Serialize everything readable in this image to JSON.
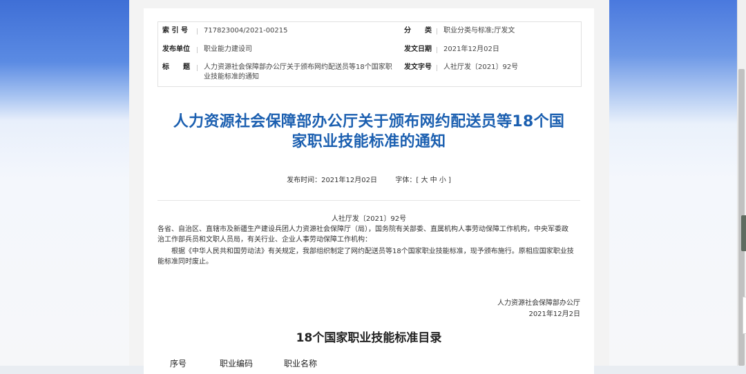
{
  "meta": {
    "index_label": "索 引 号",
    "index_value": "717823004/2021-00215",
    "category_label": "分　　类",
    "category_value": "职业分类与标准;厅发文",
    "issuer_label": "发布单位",
    "issuer_value": "职业能力建设司",
    "date_label": "发文日期",
    "date_value": "2021年12月02日",
    "title_label": "标　　题",
    "title_value_line1": "人力资源社会保障部办公厅关于颁布网约配送员等18个国家职",
    "title_value_line2": "业技能标准的通知",
    "docno_label": "发文字号",
    "docno_value": "人社厅发〔2021〕92号"
  },
  "document": {
    "title_line1": "人力资源社会保障部办公厅关于颁布网约配送员等18个国",
    "title_line2": "家职业技能标准的通知",
    "publish_label": "发布时间：2021年12月02日",
    "font_label": "字体：[",
    "font_large": "大",
    "font_medium": "中",
    "font_small": "小",
    "font_close": "]",
    "doc_number": "人社厅发〔2021〕92号",
    "salutation_line1": "各省、自治区、直辖市及新疆生产建设兵团人力资源社会保障厅（局），国务院有关部委、直属机构人事劳动保障工作机构，中央军委政",
    "salutation_line2": "治工作部兵员和文职人员局，有关行业、企业人事劳动保障工作机构：",
    "paragraph_line1": "　　根据《中华人民共和国劳动法》有关规定，我部组织制定了网约配送员等18个国家职业技能标准，现予颁布施行。原相应国家职业技",
    "paragraph_line2": "能标准同时废止。",
    "signature": "人力资源社会保障部办公厅",
    "sign_date": "2021年12月2日",
    "catalog_title": "18个国家职业技能标准目录",
    "col_index": "序号",
    "col_code": "职业编码",
    "col_name": "职业名称"
  }
}
